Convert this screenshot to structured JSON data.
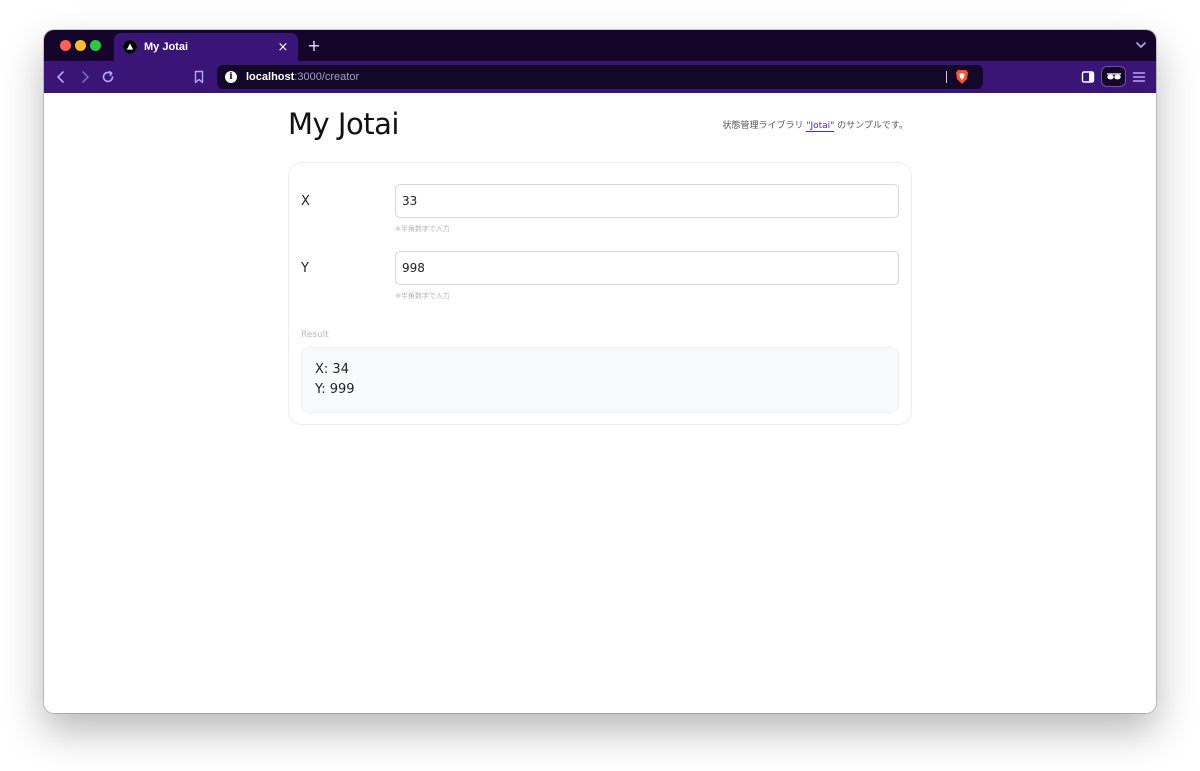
{
  "browser": {
    "tab": {
      "title": "My Jotai",
      "close_glyph": "×"
    },
    "new_tab_glyph": "+",
    "url": {
      "host": "localhost",
      "path": ":3000/creator"
    },
    "info_glyph": "i",
    "icons": [
      "back-icon",
      "forward-icon",
      "reload-icon",
      "bookmark-icon",
      "info-icon",
      "brave-shield-icon",
      "sidebar-icon",
      "private-glasses-icon",
      "menu-icon",
      "tab-list-chevron-icon"
    ],
    "colors": {
      "tabbar": "#15052a",
      "toolbar": "#3a1477",
      "urlbar": "#140828"
    }
  },
  "page": {
    "title": "My Jotai",
    "description_prefix": "状態管理ライブラリ ",
    "description_link": "\"Jotai\"",
    "description_suffix": " のサンプルです。",
    "link_color": "#4a28b8"
  },
  "form": {
    "x": {
      "label": "X",
      "value": "33",
      "hint": "※半角数字で入力"
    },
    "y": {
      "label": "Y",
      "value": "998",
      "hint": "※半角数字で入力"
    }
  },
  "result": {
    "label": "Result",
    "lines": [
      "X: 34",
      "Y: 999"
    ]
  }
}
